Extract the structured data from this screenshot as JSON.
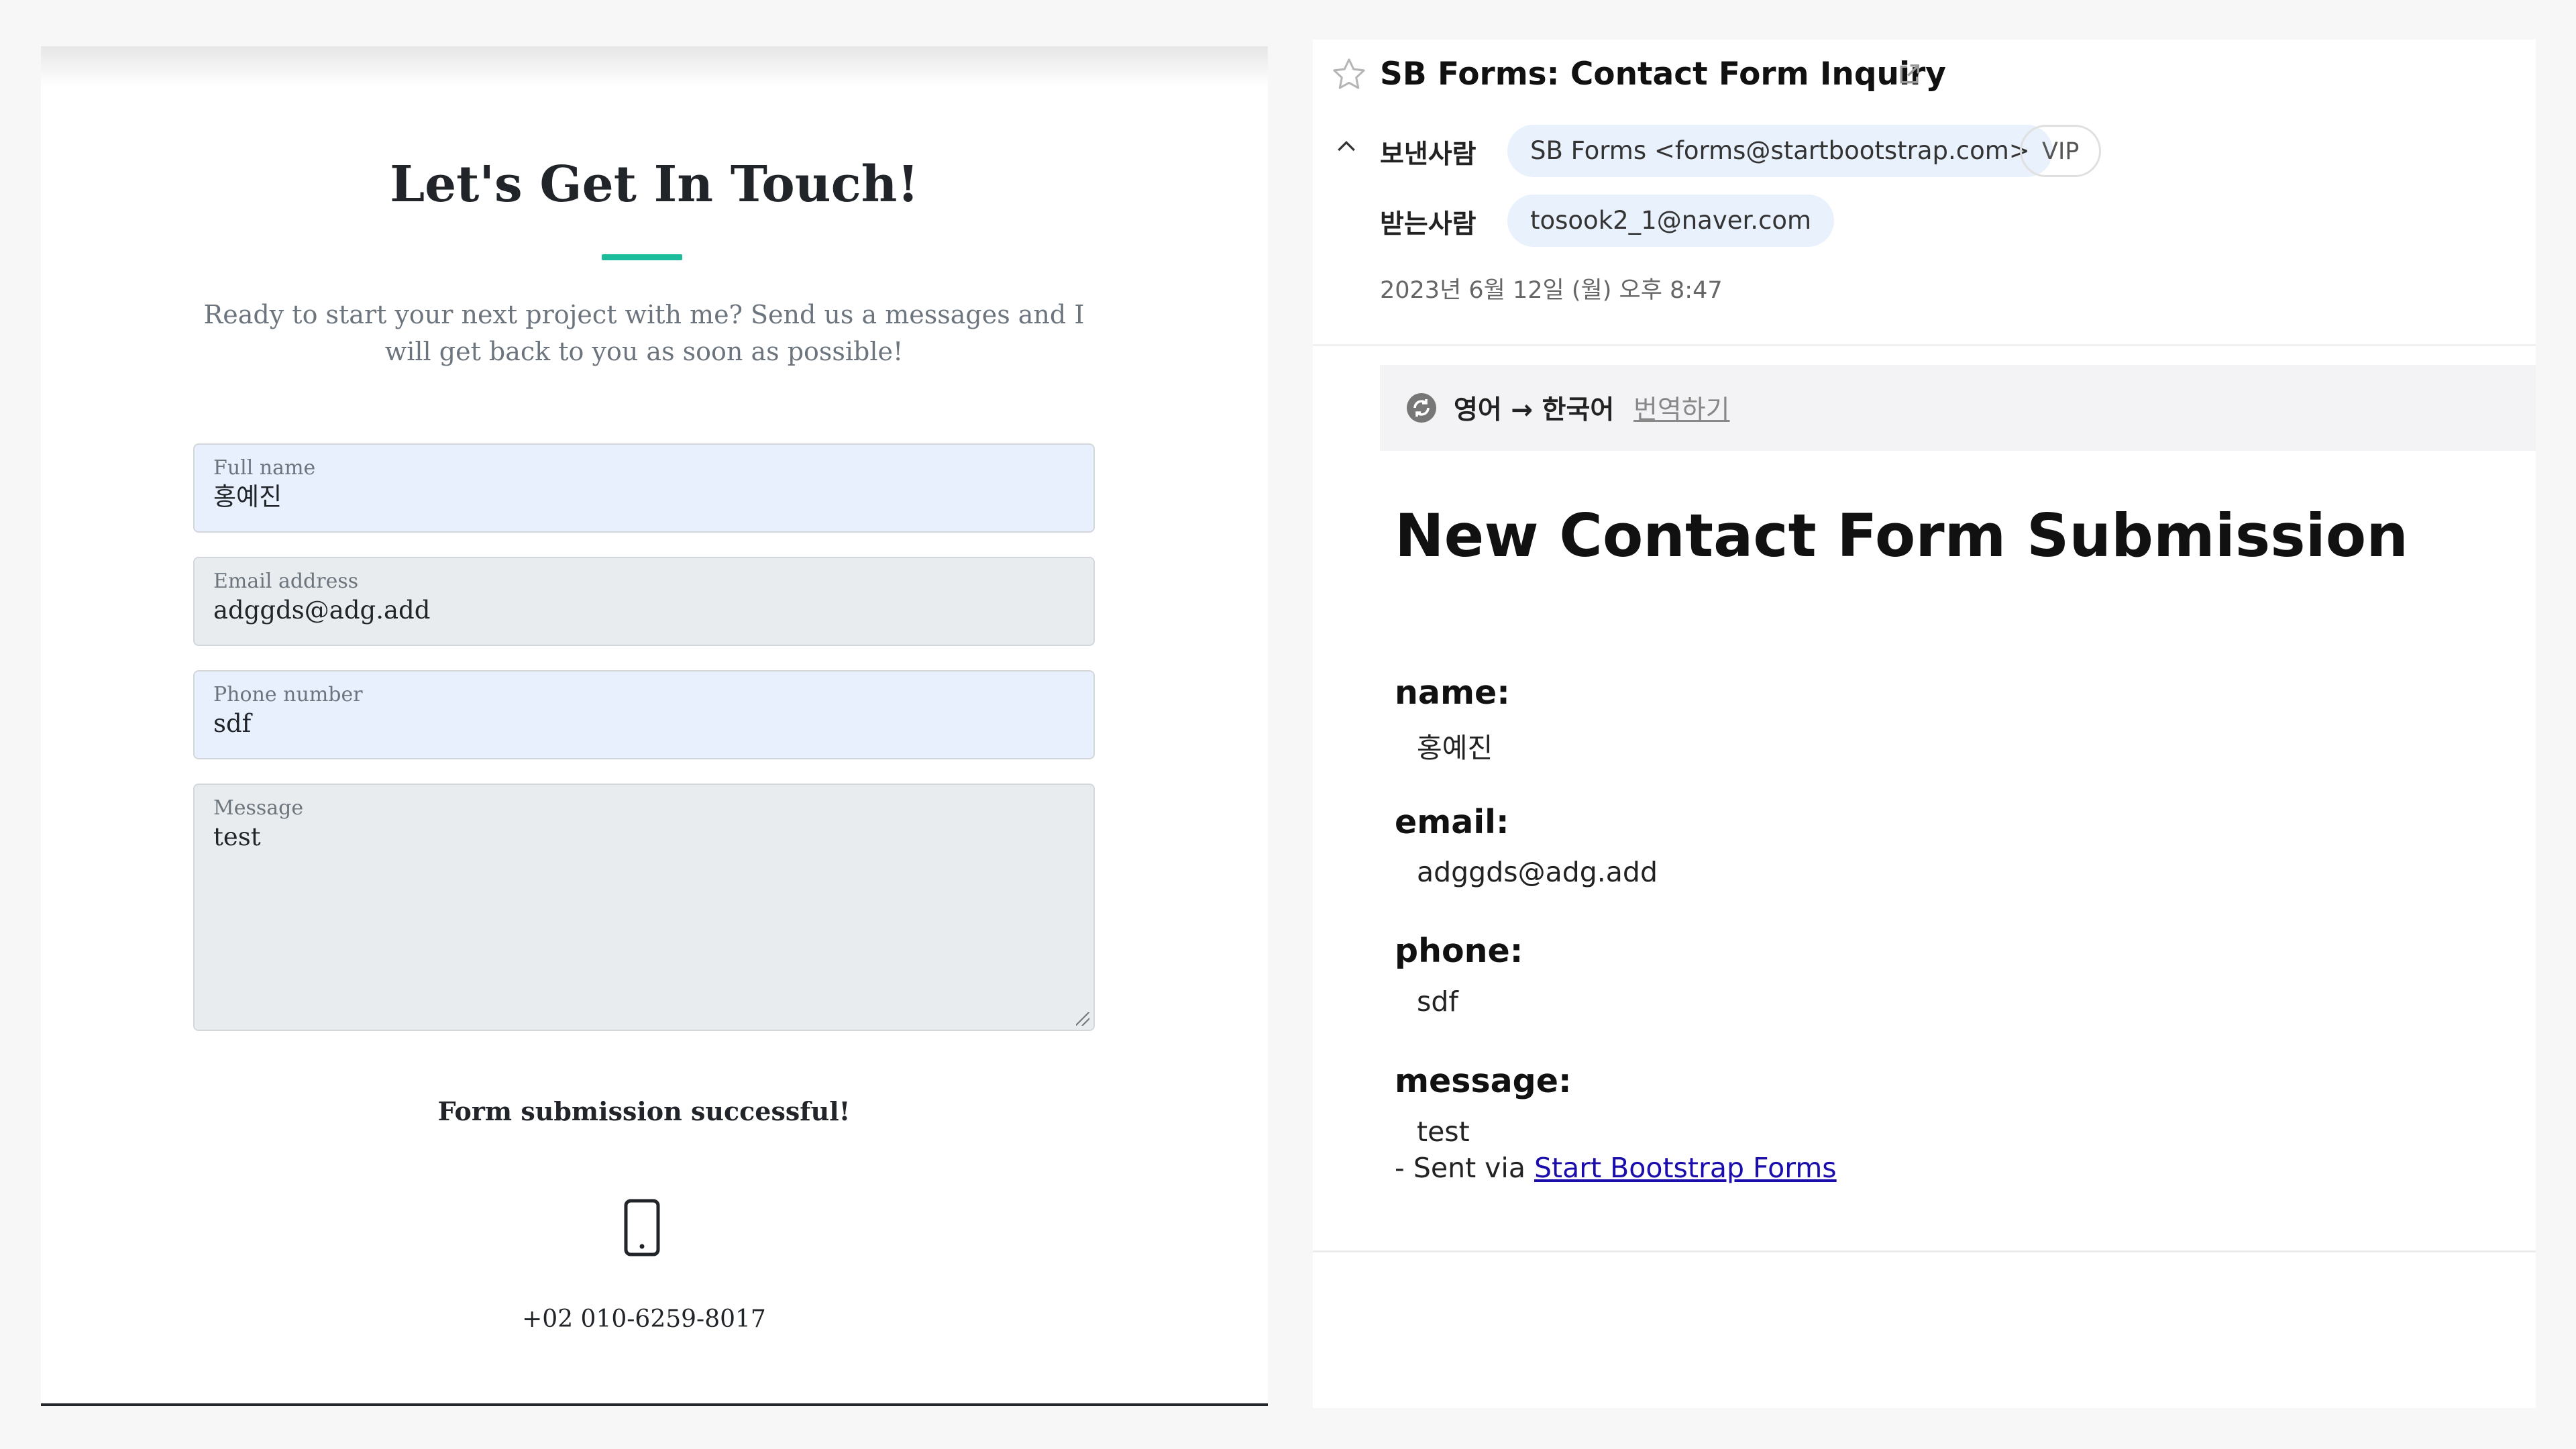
{
  "contact_form": {
    "title": "Let's Get In Touch!",
    "intro": "Ready to start your next project with me? Send us a messages and I will get back to you as soon as possible!",
    "fields": {
      "name": {
        "label": "Full name",
        "value": "홍예진"
      },
      "email": {
        "label": "Email address",
        "value": "adggds@adg.add"
      },
      "phone": {
        "label": "Phone number",
        "value": "sdf"
      },
      "message": {
        "label": "Message",
        "value": "test"
      }
    },
    "success_message": "Form submission successful!",
    "contact_phone": "+02 010-6259-8017",
    "accent_color": "#1abc9c"
  },
  "mail": {
    "subject": "SB Forms: Contact Form Inquiry",
    "from_label": "보낸사람",
    "from": "SB Forms <forms@startbootstrap.com>",
    "vip": "VIP",
    "to_label": "받는사람",
    "to": "tosook2_1@naver.com",
    "date": "2023년 6월 12일 (월) 오후 8:47",
    "translate": {
      "languages": "영어 → 한국어",
      "action": "번역하기"
    },
    "body": {
      "heading": "New Contact Form Submission",
      "name_label": "name:",
      "name_value": "홍예진",
      "email_label": "email:",
      "email_value": "adggds@adg.add",
      "phone_label": "phone:",
      "phone_value": "sdf",
      "message_label": "message:",
      "message_value": "test",
      "sent_via_prefix": "- Sent via ",
      "sent_via_link": "Start Bootstrap Forms"
    },
    "link_color": "#1a0dab"
  },
  "icons": [
    "phone-icon",
    "star-icon",
    "external-link-icon",
    "chevron-up-icon",
    "translate-icon",
    "resize-grip-icon"
  ]
}
